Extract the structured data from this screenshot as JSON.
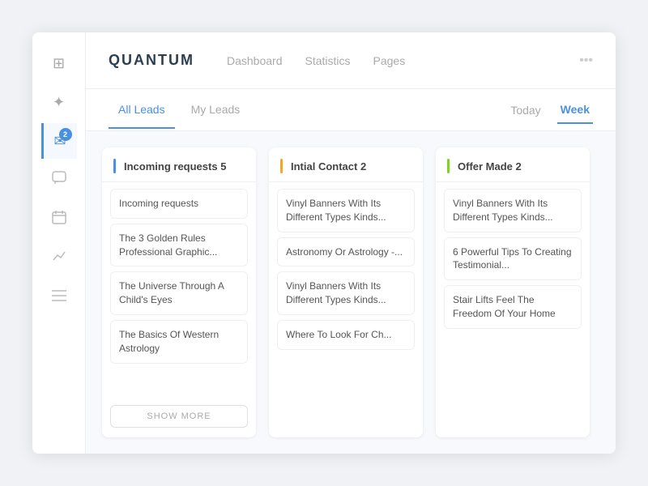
{
  "app": {
    "logo": "QUANTUM"
  },
  "header": {
    "nav": [
      {
        "label": "Dashboard",
        "active": false
      },
      {
        "label": "Statistics",
        "active": false
      },
      {
        "label": "Pages",
        "active": false
      }
    ],
    "more_icon": "•••"
  },
  "sidebar": {
    "items": [
      {
        "name": "dashboard-icon",
        "icon": "⊞",
        "active": false,
        "badge": null
      },
      {
        "name": "plugins-icon",
        "icon": "✦",
        "active": false,
        "badge": null
      },
      {
        "name": "mail-icon",
        "icon": "✉",
        "active": true,
        "badge": "2"
      },
      {
        "name": "chat-icon",
        "icon": "💬",
        "active": false,
        "badge": null
      },
      {
        "name": "calendar-icon",
        "icon": "▦",
        "active": false,
        "badge": null
      },
      {
        "name": "analytics-icon",
        "icon": "∿",
        "active": false,
        "badge": null
      },
      {
        "name": "menu-icon",
        "icon": "≡",
        "active": false,
        "badge": null
      }
    ]
  },
  "tabs": {
    "lead_tabs": [
      {
        "label": "All Leads",
        "active": true
      },
      {
        "label": "My Leads",
        "active": false
      }
    ],
    "time_tabs": [
      {
        "label": "Today",
        "active": false
      },
      {
        "label": "Week",
        "active": true
      }
    ]
  },
  "columns": [
    {
      "id": "incoming",
      "title": "Incoming requests 5",
      "accent_color": "#4a90e2",
      "cards": [
        {
          "text": "Incoming requests"
        },
        {
          "text": "The 3 Golden Rules Professional Graphic..."
        },
        {
          "text": "The Universe Through A Child's Eyes"
        },
        {
          "text": "The Basics Of Western Astrology"
        }
      ],
      "show_more": true,
      "show_more_label": "SHOW MORE"
    },
    {
      "id": "initial-contact",
      "title": "Intial Contact 2",
      "accent_color": "#f5a623",
      "cards": [
        {
          "text": "Vinyl Banners With Its Different Types Kinds..."
        },
        {
          "text": "Astronomy Or Astrology -..."
        },
        {
          "text": "Vinyl Banners With Its Different Types Kinds..."
        },
        {
          "text": "Where To Look For Ch..."
        }
      ],
      "show_more": false
    },
    {
      "id": "offer-made",
      "title": "Offer Made 2",
      "accent_color": "#7ed321",
      "cards": [
        {
          "text": "Vinyl Banners With Its Different Types Kinds..."
        },
        {
          "text": "6 Powerful Tips To Creating Testimonial..."
        },
        {
          "text": "Stair Lifts Feel The Freedom Of Your Home"
        }
      ],
      "show_more": false
    }
  ]
}
